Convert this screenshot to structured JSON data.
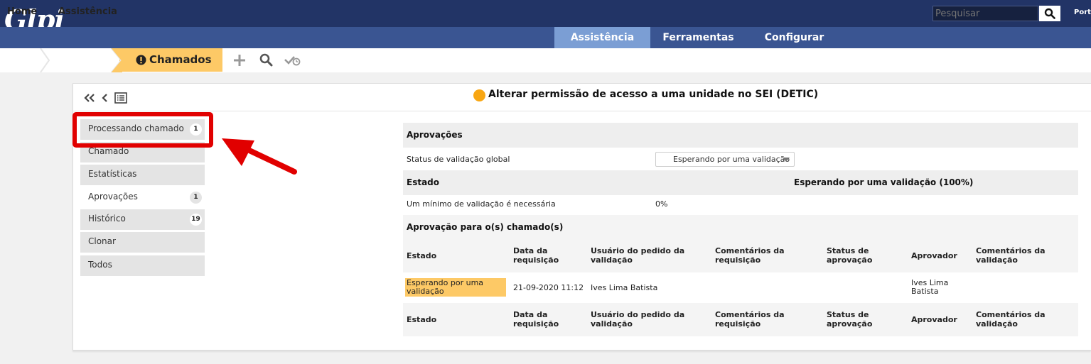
{
  "header": {
    "logo": "Glpi",
    "search_placeholder": "Pesquisar",
    "right_text": "Port"
  },
  "menu": [
    {
      "label": "Assistência",
      "active": true
    },
    {
      "label": "Ferramentas",
      "active": false
    },
    {
      "label": "Configurar",
      "active": false
    }
  ],
  "breadcrumb": {
    "home": "Home",
    "assistencia": "Assistência",
    "current": "Chamados"
  },
  "ticket": {
    "title": "Alterar permissão de acesso a uma unidade no SEI (DETIC)",
    "status_color": "#f8a612"
  },
  "tabs": [
    {
      "label": "Processando chamado",
      "badge": "1"
    },
    {
      "label": "Chamado",
      "badge": ""
    },
    {
      "label": "Estatísticas",
      "badge": ""
    },
    {
      "label": "Aprovações",
      "badge": "1"
    },
    {
      "label": "Histórico",
      "badge": "19"
    },
    {
      "label": "Clonar",
      "badge": ""
    },
    {
      "label": "Todos",
      "badge": ""
    }
  ],
  "approvals": {
    "section_title": "Aprovações",
    "global_status_label": "Status de validação global",
    "global_status_value": "Esperando por uma validação",
    "state_label": "Estado",
    "state_value": "Esperando por uma validação (100%)",
    "min_validation_label": "Um mínimo de validação é necessária",
    "min_validation_value": "0%",
    "subsection_title": "Aprovação para o(s) chamado(s)",
    "columns": [
      "Estado",
      "Data da requisição",
      "Usuário do pedido da validação",
      "Comentários da requisição",
      "Status de aprovação",
      "Aprovador",
      "Comentários da validação"
    ],
    "rows": [
      {
        "estado": "Esperando por uma validação",
        "data": "21-09-2020 11:12",
        "usuario": "Ives Lima Batista",
        "comentarios_req": "",
        "status": "",
        "aprovador": "Ives Lima Batista",
        "comentarios_val": ""
      }
    ]
  },
  "colors": {
    "topbar": "#223466",
    "navbar": "#3a5592",
    "active_menu": "#7b9ed4",
    "breadcrumb_active": "#fdc966",
    "highlight": "#e10000"
  }
}
